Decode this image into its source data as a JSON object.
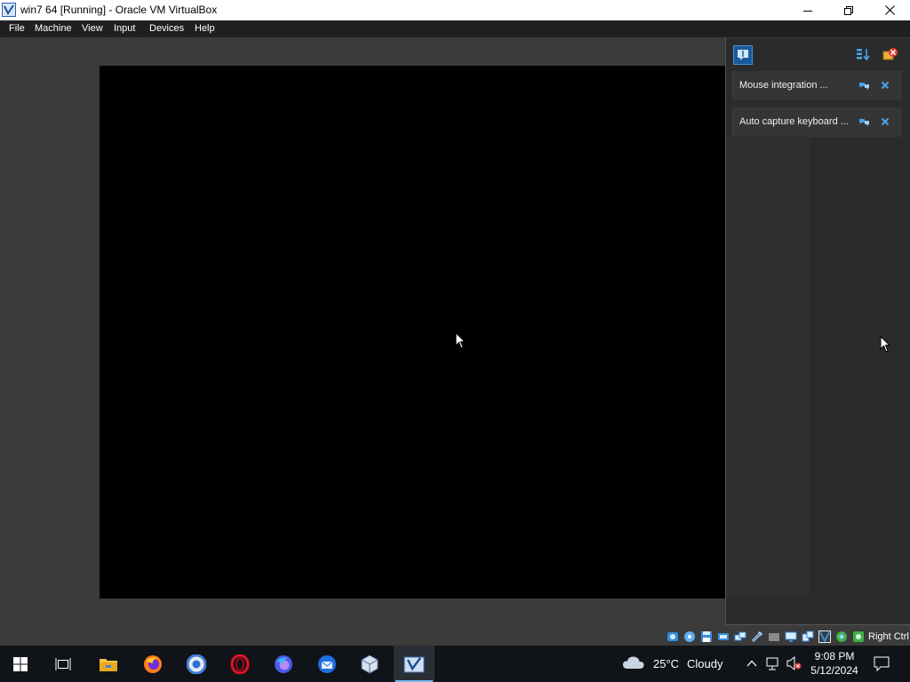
{
  "window": {
    "title": "win7 64 [Running] - Oracle VM VirtualBox",
    "controls": [
      "minimize-icon",
      "restore-icon",
      "close-icon"
    ]
  },
  "menu": {
    "items": [
      "File",
      "Machine",
      "View",
      "Input",
      "Devices",
      "Help"
    ]
  },
  "notification_center": {
    "buttons": [
      "notification-center-icon",
      "sort-icon",
      "clear-all-icon"
    ],
    "items": [
      {
        "text": "Mouse integration ...",
        "actions": [
          "toggle-icon",
          "close-icon"
        ]
      },
      {
        "text": "Auto capture keyboard ...",
        "actions": [
          "toggle-icon",
          "close-icon"
        ]
      }
    ]
  },
  "statusbar": {
    "icons": [
      "hard-disk-icon",
      "optical-drive-icon",
      "floppy-icon",
      "audio-icon",
      "network-icon",
      "usb-icon",
      "shared-folder-icon",
      "display-icon",
      "recording-icon",
      "cpu-icon",
      "mouse-integration-icon",
      "keyboard-icon"
    ],
    "host_key": "Right Ctrl"
  },
  "taskbar": {
    "apps": [
      "windows-start-icon",
      "task-view-icon",
      "file-explorer-icon",
      "firefox-icon",
      "chrome-icon",
      "opera-icon",
      "firefox-developer-icon",
      "thunderbird-icon",
      "virtualbox-icon",
      "virtualbox-vm-icon"
    ],
    "weather": {
      "temp": "25°C",
      "condition": "Cloudy"
    },
    "time": "9:08 PM",
    "date": "5/12/2024"
  },
  "colors": {
    "accent": "#76b9ed",
    "vm_background": "#000000",
    "panel_bg": "#2b2b2b"
  }
}
